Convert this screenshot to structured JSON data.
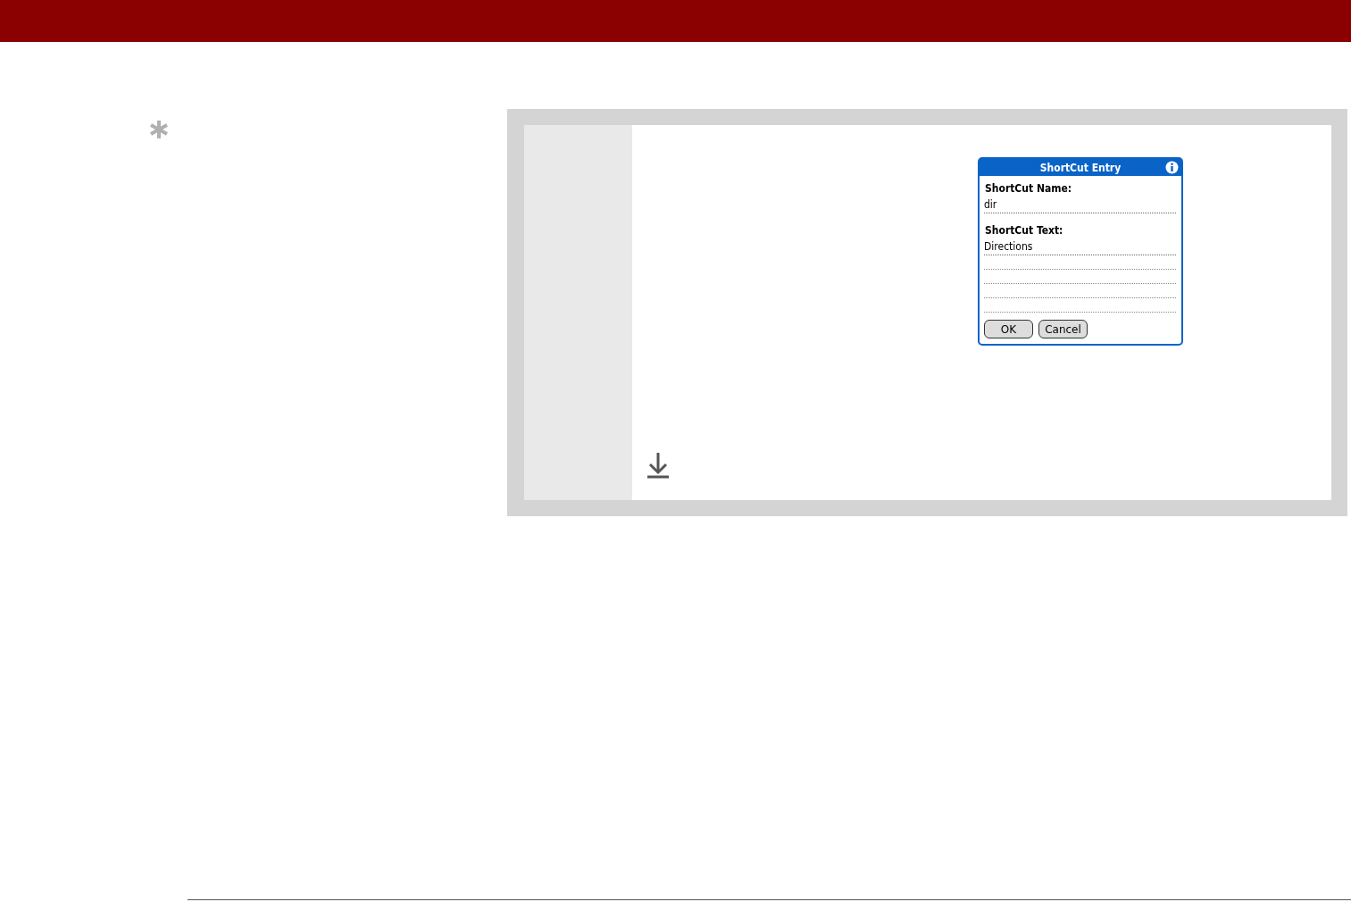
{
  "dialog": {
    "title": "ShortCut Entry",
    "fields": [
      {
        "label": "ShortCut Name:",
        "value": "dir"
      },
      {
        "label": "ShortCut Text:",
        "value": "Directions"
      }
    ],
    "buttons": [
      "OK",
      "Cancel"
    ]
  }
}
